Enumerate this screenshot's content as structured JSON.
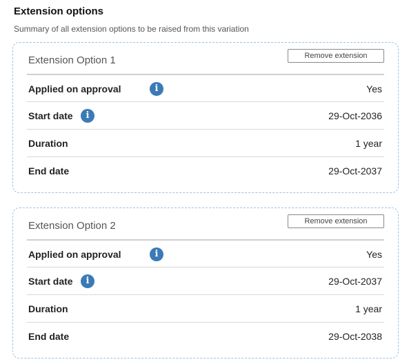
{
  "header": {
    "title": "Extension options",
    "subtitle": "Summary of all extension options to be raised from this variation"
  },
  "options": [
    {
      "title": "Extension Option 1",
      "remove_label": "Remove extension",
      "applied_label": "Applied on approval",
      "applied_value": "Yes",
      "start_label": "Start date",
      "start_value": "29-Oct-2036",
      "duration_label": "Duration",
      "duration_value": "1 year",
      "end_label": "End date",
      "end_value": "29-Oct-2037"
    },
    {
      "title": "Extension Option 2",
      "remove_label": "Remove extension",
      "applied_label": "Applied on approval",
      "applied_value": "Yes",
      "start_label": "Start date",
      "start_value": "29-Oct-2037",
      "duration_label": "Duration",
      "duration_value": "1 year",
      "end_label": "End date",
      "end_value": "29-Oct-2038"
    }
  ],
  "icons": {
    "info": "info-icon",
    "info_glyph": "i"
  },
  "colors": {
    "accent": "#3b7ab7",
    "card_border": "#9cc1df"
  }
}
